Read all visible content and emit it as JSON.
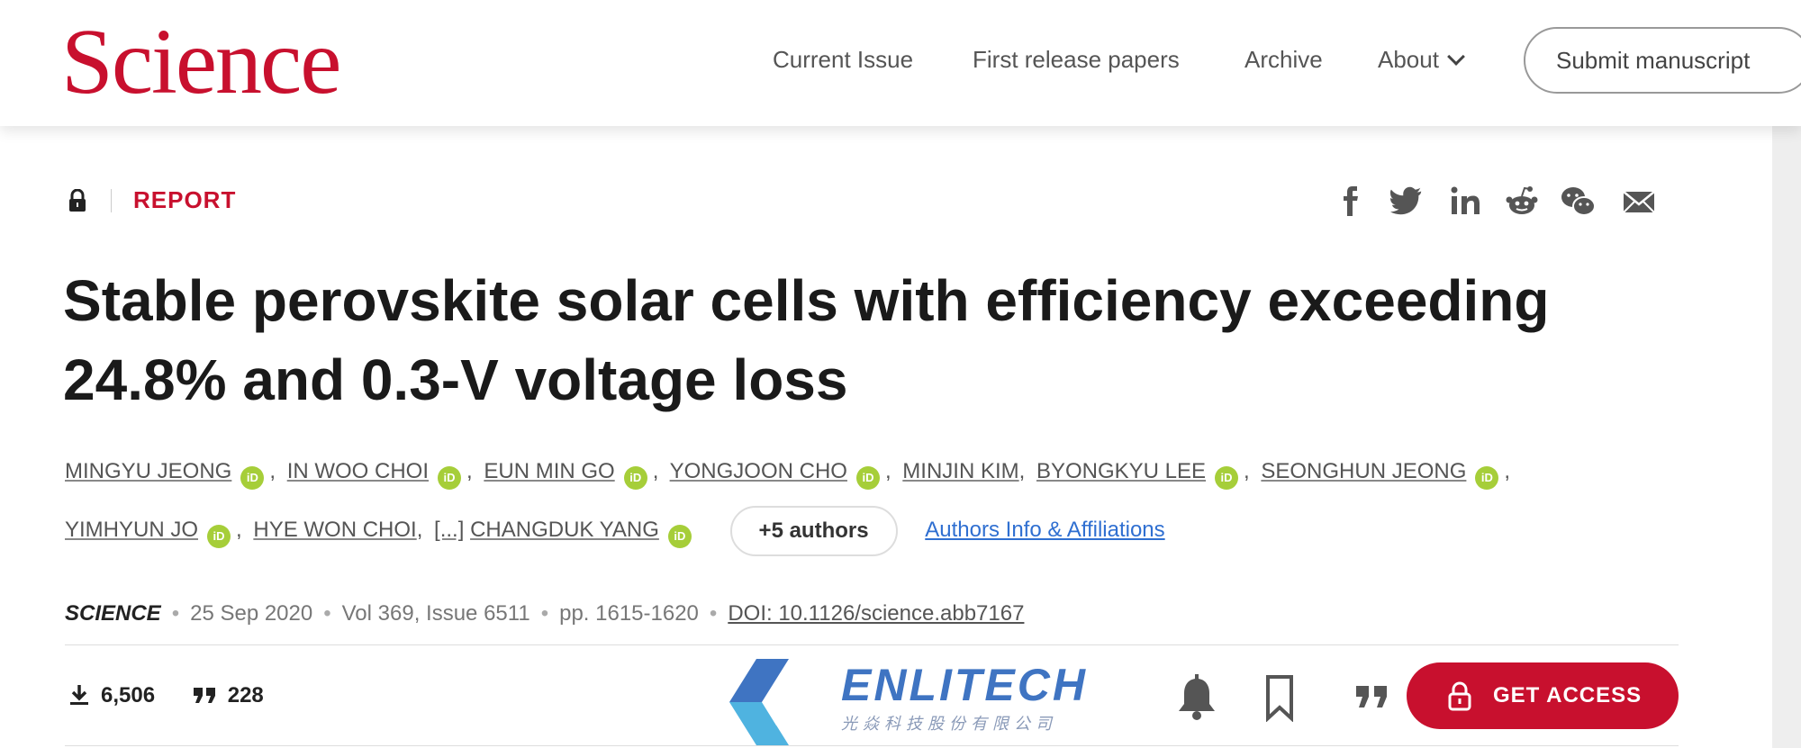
{
  "header": {
    "logo": "Science",
    "nav": [
      {
        "label": "Current Issue"
      },
      {
        "label": "First release papers"
      },
      {
        "label": "Archive"
      },
      {
        "label": "About"
      }
    ],
    "submit_label": "Submit manuscript"
  },
  "article": {
    "type_label": "REPORT",
    "title_line1": "Stable perovskite solar cells with efficiency exceeding",
    "title_line2": "24.8% and 0.3-V voltage loss",
    "authors_line1": [
      "MINGYU JEONG",
      "IN WOO CHOI",
      "EUN MIN GO",
      "YONGJOON CHO",
      "MINJIN KIM",
      "BYONGKYU LEE",
      "SEONGHUN JEONG"
    ],
    "authors_line2": [
      "YIMHYUN JO",
      "HYE WON CHOI",
      "CHANGDUK YANG"
    ],
    "ellipsis": "[...]",
    "more_authors": "+5 authors",
    "affiliations_link": "Authors Info & Affiliations",
    "journal": "SCIENCE",
    "date": "25 Sep 2020",
    "volume": "Vol 369, Issue 6511",
    "pages": "pp. 1615-1620",
    "doi": "DOI: 10.1126/science.abb7167"
  },
  "metrics": {
    "downloads": "6,506",
    "citations": "228"
  },
  "watermark": {
    "brand": "ENLITECH",
    "subtitle": "光焱科技股份有限公司"
  },
  "actions": {
    "access_label": "GET ACCESS"
  },
  "colors": {
    "brand_red": "#c8102e",
    "orcid_green": "#a6ce39",
    "link_blue": "#2f6fd1"
  }
}
